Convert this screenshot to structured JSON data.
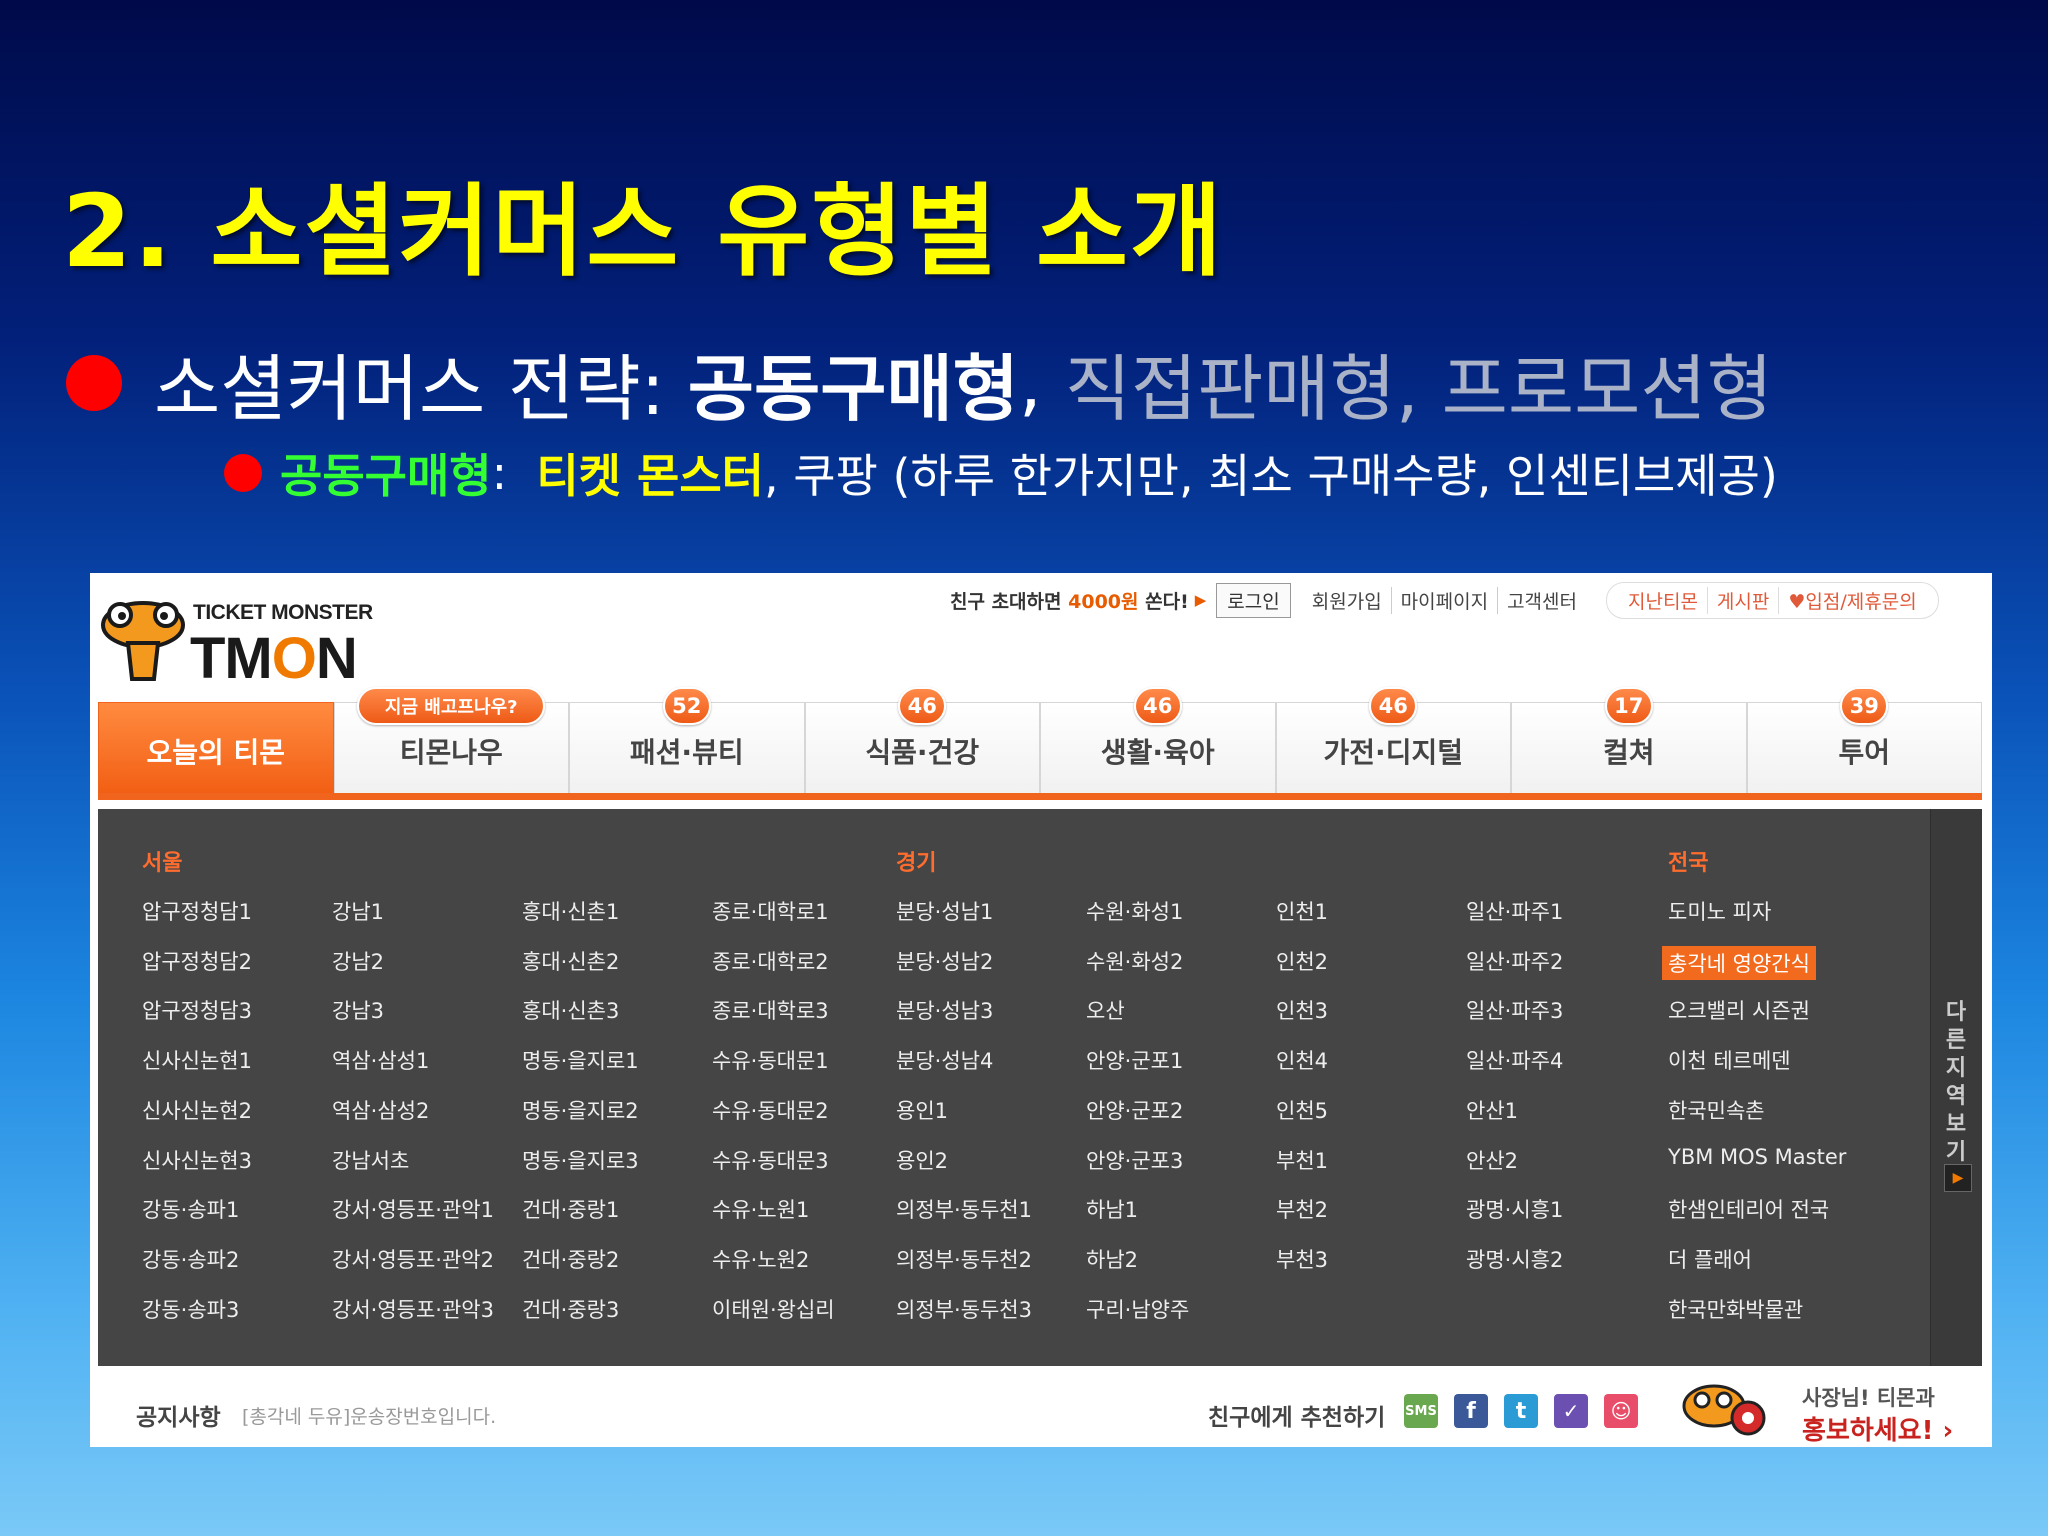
{
  "slide": {
    "title": "2. 소셜커머스 유형별 소개",
    "bullet1": {
      "prefix": "소셜커머스 전략: ",
      "strong": "공동구매형",
      "comma": ",",
      "dim": " 직접판매형, 프로모션형"
    },
    "bullet2": {
      "label": "공동구매형",
      "colon": ":  ",
      "highlight": "티켓 몬스터",
      "rest": ", 쿠팡 (하루 한가지만, 최소 구매수량, 인센티브제공)"
    }
  },
  "site": {
    "logo_top": "TICKET MONSTER",
    "logo_t": "TM",
    "logo_o": "O",
    "logo_n": "N",
    "topbar": {
      "invite_pre": "친구 초대하면 ",
      "invite_amount": "4000원",
      "invite_post": " 쏜다!",
      "login": "로그인",
      "links": [
        "회원가입",
        "마이페이지",
        "고객센터"
      ],
      "pills": [
        "지난티몬",
        "게시판",
        "♥입점/제휴문의"
      ]
    },
    "nav": [
      {
        "label": "오늘의 티몬",
        "badge": ""
      },
      {
        "label": "티몬나우",
        "badge": "지금 배고프나우?"
      },
      {
        "label": "패션·뷰티",
        "badge": "52"
      },
      {
        "label": "식품·건강",
        "badge": "46"
      },
      {
        "label": "생활·육아",
        "badge": "46"
      },
      {
        "label": "가전·디지털",
        "badge": "46"
      },
      {
        "label": "컬쳐",
        "badge": "17"
      },
      {
        "label": "투어",
        "badge": "39"
      }
    ],
    "regions": {
      "seoul": "서울",
      "gyeonggi": "경기",
      "national": "전국"
    },
    "columns": [
      [
        "압구정청담1",
        "압구정청담2",
        "압구정청담3",
        "신사신논현1",
        "신사신논현2",
        "신사신논현3",
        "강동·송파1",
        "강동·송파2",
        "강동·송파3"
      ],
      [
        "강남1",
        "강남2",
        "강남3",
        "역삼·삼성1",
        "역삼·삼성2",
        "강남서초",
        "강서·영등포·관악1",
        "강서·영등포·관악2",
        "강서·영등포·관악3"
      ],
      [
        "홍대·신촌1",
        "홍대·신촌2",
        "홍대·신촌3",
        "명동·을지로1",
        "명동·을지로2",
        "명동·을지로3",
        "건대·중랑1",
        "건대·중랑2",
        "건대·중랑3"
      ],
      [
        "종로·대학로1",
        "종로·대학로2",
        "종로·대학로3",
        "수유·동대문1",
        "수유·동대문2",
        "수유·동대문3",
        "수유·노원1",
        "수유·노원2",
        "이태원·왕십리"
      ],
      [
        "분당·성남1",
        "분당·성남2",
        "분당·성남3",
        "분당·성남4",
        "용인1",
        "용인2",
        "의정부·동두천1",
        "의정부·동두천2",
        "의정부·동두천3"
      ],
      [
        "수원·화성1",
        "수원·화성2",
        "오산",
        "안양·군포1",
        "안양·군포2",
        "안양·군포3",
        "하남1",
        "하남2",
        "구리·남양주"
      ],
      [
        "인천1",
        "인천2",
        "인천3",
        "인천4",
        "인천5",
        "부천1",
        "부천2",
        "부천3"
      ],
      [
        "일산·파주1",
        "일산·파주2",
        "일산·파주3",
        "일산·파주4",
        "안산1",
        "안산2",
        "광명·시흥1",
        "광명·시흥2"
      ],
      [
        "도미노 피자",
        "총각네 영양간식",
        "오크밸리 시즌권",
        "이천 테르메덴",
        "한국민속촌",
        "YBM MOS Master",
        "한샘인테리어 전국",
        "더 플래어",
        "한국만화박물관"
      ]
    ],
    "highlighted_item": "총각네 영양간식",
    "side_more": "다른 지역보기",
    "footer": {
      "notice_label": "공지사항",
      "notice_text": "[총각네 두유]운송장번호입니다.",
      "recommend": "친구에게 추천하기",
      "share_icons": [
        "sms-icon",
        "facebook-icon",
        "twitter-icon",
        "me2day-icon",
        "yozm-icon"
      ],
      "share_labels": [
        "SMS",
        "f",
        "t",
        "✓",
        "☺"
      ],
      "boss_line1": "사장님! 티몬과",
      "boss_line2": "홍보하세요! ›"
    },
    "colors": {
      "accent": "#f0641e",
      "panel": "#454545",
      "region": "#ff6d2e"
    }
  }
}
